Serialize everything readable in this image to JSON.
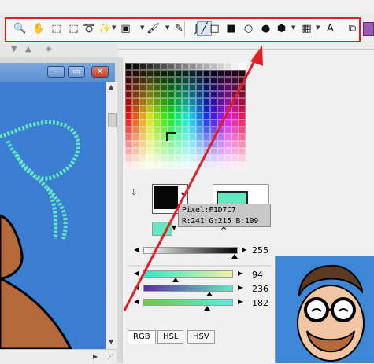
{
  "toolbar": {
    "tools": [
      {
        "icon": "zoom-icon",
        "glyph": "🔍"
      },
      {
        "icon": "hand-icon",
        "glyph": "✋"
      },
      {
        "icon": "rect-select-icon",
        "glyph": "⬚"
      },
      {
        "icon": "crop-select-icon",
        "glyph": "⬚"
      },
      {
        "icon": "lasso-icon",
        "glyph": "➰"
      },
      {
        "icon": "magic-wand-icon",
        "glyph": "✨"
      },
      {
        "icon": "color-fill-icon",
        "glyph": "▣"
      },
      {
        "icon": "brush-icon",
        "glyph": "🖌"
      },
      {
        "icon": "pen-icon",
        "glyph": "✎"
      },
      {
        "icon": "curve-icon",
        "glyph": "ʃ"
      },
      {
        "icon": "line-icon",
        "glyph": "╱"
      },
      {
        "icon": "rectangle-outline-icon",
        "glyph": "□"
      },
      {
        "icon": "rectangle-filled-icon",
        "glyph": "■"
      },
      {
        "icon": "ellipse-outline-icon",
        "glyph": "○"
      },
      {
        "icon": "ellipse-filled-icon",
        "glyph": "●"
      },
      {
        "icon": "paint-bucket-icon",
        "glyph": "⬢"
      },
      {
        "icon": "gradient-icon",
        "glyph": "▦"
      },
      {
        "icon": "text-icon",
        "glyph": "A"
      },
      {
        "icon": "restore-window-icon",
        "glyph": "⧉"
      }
    ]
  },
  "pixel_info": {
    "line1": "Pixel:F1D7C7",
    "line2": "R:241 G:215 B:199"
  },
  "gray_slider": {
    "value": "255"
  },
  "color_sliders": [
    {
      "value": "94"
    },
    {
      "value": "236"
    },
    {
      "value": "182"
    }
  ],
  "tabs": [
    {
      "label": "RGB"
    },
    {
      "label": "HSL"
    },
    {
      "label": "HSV"
    }
  ],
  "colors": {
    "primary": "#080808",
    "secondary": "#63e7c1",
    "highlight": "#e31e24"
  }
}
